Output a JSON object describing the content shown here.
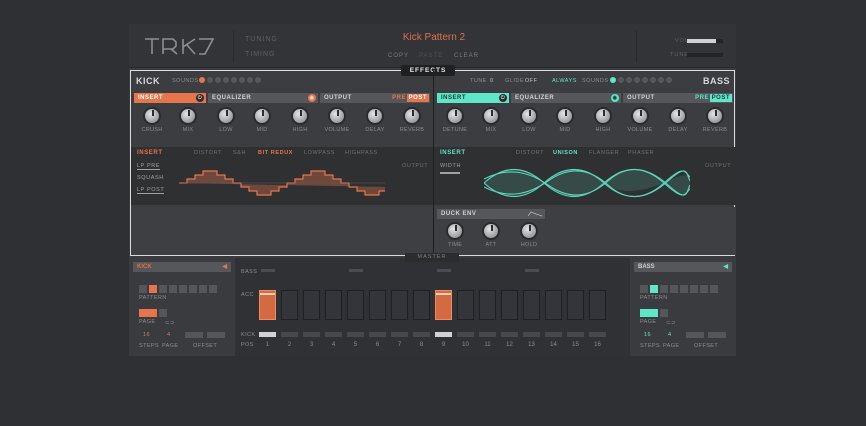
{
  "header": {
    "tuning_label": "TUNING",
    "timing_label": "TIMING",
    "pattern_title": "Kick Pattern 2",
    "copy": "COPY",
    "paste": "PASTE",
    "clear": "CLEAR",
    "vol_label": "VOL",
    "tune_label": "TUNE",
    "vol_level": 0.8,
    "tune_level": 0.0
  },
  "effects_tab": "EFFECTS",
  "left": {
    "name": "KICK",
    "sounds_label": "SOUNDS",
    "insert_label": "INSERT",
    "eq_label": "EQUALIZER",
    "output_label": "OUTPUT",
    "pre": "PRE",
    "post": "POST",
    "knobs": [
      "CRUSH",
      "MIX",
      "LOW",
      "MID",
      "HIGH",
      "VOLUME",
      "DELAY",
      "REVERB"
    ],
    "insert_head": "INSERT",
    "insert_opts": [
      "DISTORT",
      "S&H",
      "BIT REDUX",
      "LOWPASS",
      "HIGHPASS"
    ],
    "output_small": "OUTPUT",
    "side_opts": [
      "LP PRE",
      "SQUASH",
      "LP POST"
    ]
  },
  "right": {
    "name": "BASS",
    "tune_label": "TUNE",
    "tune_val": "0",
    "glide_label": "GLIDE",
    "glide_val": "OFF",
    "always": "ALWAYS",
    "sounds_label": "SOUNDS",
    "insert_label": "INSERT",
    "eq_label": "EQUALIZER",
    "output_label": "OUTPUT",
    "pre": "PRE",
    "post": "POST",
    "knobs": [
      "DETUNE",
      "MIX",
      "LOW",
      "MID",
      "HIGH",
      "VOLUME",
      "DELAY",
      "REVERB"
    ],
    "insert_head": "INSERT",
    "insert_opts": [
      "DISTORT",
      "UNISON",
      "FLANGER",
      "PHASER"
    ],
    "width_label": "WIDTH",
    "output_small": "OUTPUT",
    "duck_label": "DUCK ENV",
    "duck_knobs": [
      "TIME",
      "ATT",
      "HOLD"
    ]
  },
  "sequencer": {
    "master_tab": "MASTER",
    "left_name": "KICK",
    "right_name": "BASS",
    "pattern_label": "PATTERN",
    "page_label": "PAGE",
    "steps_label": "STEPS",
    "page_short": "PAGE",
    "offset_label": "OFFSET",
    "steps_val": "16",
    "page_val": "4",
    "row_labels": [
      "BASS",
      "ACC",
      "KICK",
      "POS"
    ],
    "step_numbers": [
      "1",
      "2",
      "3",
      "4",
      "5",
      "6",
      "7",
      "8",
      "9",
      "10",
      "11",
      "12",
      "13",
      "14",
      "15",
      "16"
    ],
    "active_steps": [
      1,
      9
    ]
  },
  "colors": {
    "kick": "#e6754b",
    "bass": "#5ee6c9"
  }
}
